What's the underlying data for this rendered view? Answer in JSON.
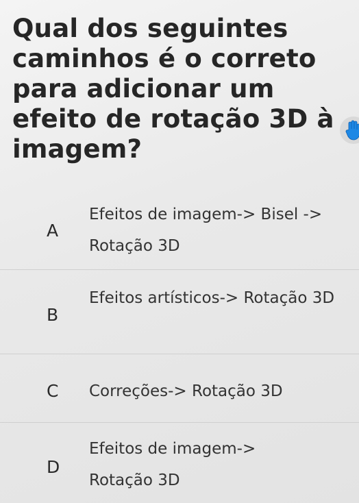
{
  "question": {
    "text": "Qual dos seguintes caminhos é o correto para adicionar um efeito de rotação 3D à imagem?"
  },
  "hint_icon": "hand-raised-icon",
  "colors": {
    "background": "#eeeeee",
    "question_text": "#262626",
    "option_text": "#333333",
    "divider": "#cfcfcf",
    "hand_icon_blue": "#1e88e5"
  },
  "options": [
    {
      "letter": "A",
      "text": "Efeitos de imagem-> Bisel -> Rotação 3D"
    },
    {
      "letter": "B",
      "text": "Efeitos artísticos-> Rotação 3D"
    },
    {
      "letter": "C",
      "text": "Correções-> Rotação 3D"
    },
    {
      "letter": "D",
      "text": "Efeitos de imagem-> Rotação 3D"
    }
  ]
}
